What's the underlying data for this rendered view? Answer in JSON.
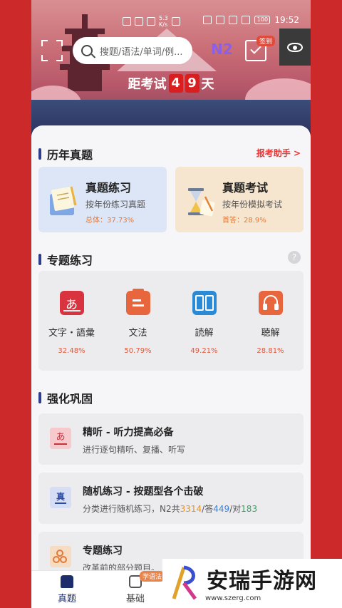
{
  "statusbar": {
    "net": "5.3\nK/s",
    "battery": "100",
    "time": "19:52"
  },
  "search": {
    "placeholder": "搜题/语法/单词/例..."
  },
  "level": "N2",
  "checkin_badge": "签到",
  "countdown": {
    "prefix": "距考试",
    "digits": [
      "4",
      "9"
    ],
    "suffix": "天"
  },
  "past_exams": {
    "title": "历年真题",
    "link": "报考助手 >",
    "cards": [
      {
        "title": "真题练习",
        "subtitle": "按年份练习真题",
        "rate": "总体：37.73%"
      },
      {
        "title": "真题考试",
        "subtitle": "按年份模拟考试",
        "rate": "首答：28.9%"
      }
    ]
  },
  "topics": {
    "title": "专题练习",
    "help": "?",
    "items": [
      {
        "name": "文字・語彙",
        "pct": "32.48%",
        "icon": "あ",
        "color": "#d9333f"
      },
      {
        "name": "文法",
        "pct": "50.79%",
        "icon": "",
        "color": "#e8663d"
      },
      {
        "name": "読解",
        "pct": "49.21%",
        "icon": "",
        "color": "#2b8ad6"
      },
      {
        "name": "聴解",
        "pct": "28.81%",
        "icon": "",
        "color": "#e8663d"
      }
    ]
  },
  "strengthen": {
    "title": "强化巩固",
    "items": [
      {
        "title": "精听 - 听力提高必备",
        "subtitle": "进行逐句精听、复播、听写",
        "icon": "あ"
      },
      {
        "title": "随机练习 - 按题型各个击破",
        "subtitle_prefix": "分类进行随机练习，N2共",
        "n1": "3314",
        "sep1": "/答",
        "n2": "449",
        "sep2": "/对",
        "n3": "183",
        "icon": "真"
      },
      {
        "title": "专题练习",
        "subtitle": "改革前的部分题目。",
        "icon": ""
      }
    ]
  },
  "tabs": [
    {
      "label": "真题"
    },
    {
      "label": "基础"
    }
  ],
  "tab_badge": "学语法",
  "watermark": {
    "title": "安瑞手游网",
    "url": "www.szerg.com"
  }
}
